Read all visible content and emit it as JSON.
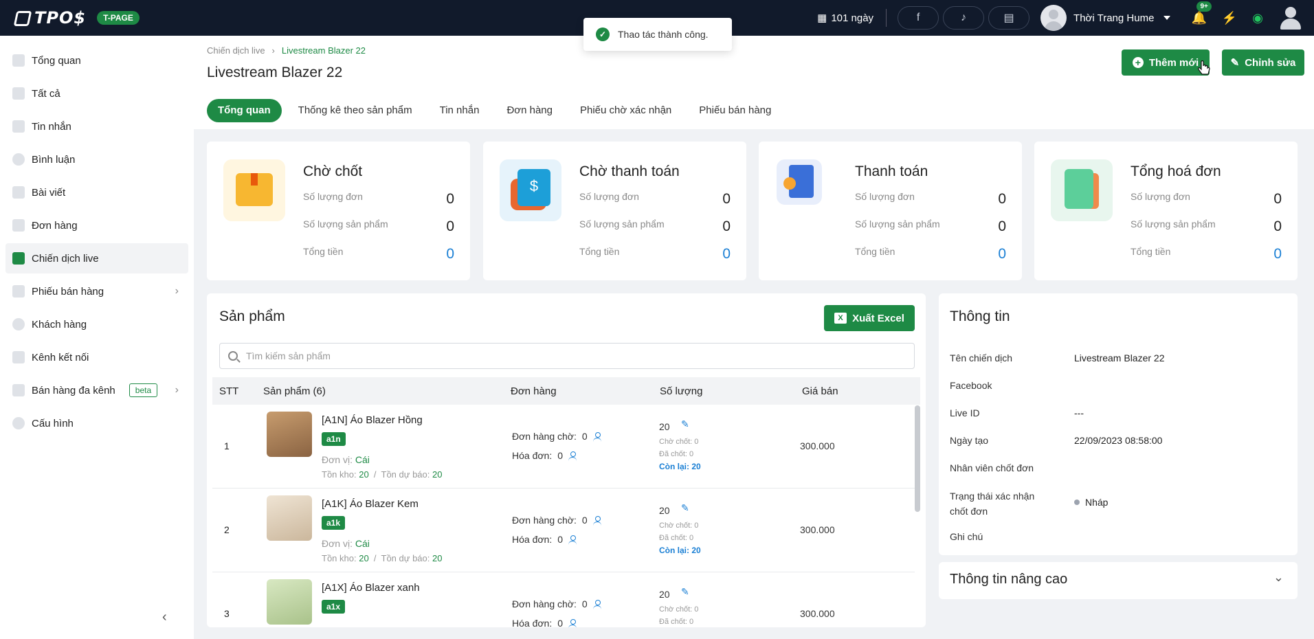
{
  "topbar": {
    "logo_text": "TPO$",
    "badge": "T-PAGE",
    "days": "101 ngày",
    "shop_name": "Thời Trang Hume",
    "notif_count": "9+"
  },
  "toast": {
    "message": "Thao tác thành công."
  },
  "sidebar": {
    "items": [
      {
        "label": "Tổng quan"
      },
      {
        "label": "Tất cả"
      },
      {
        "label": "Tin nhắn"
      },
      {
        "label": "Bình luận"
      },
      {
        "label": "Bài viết"
      },
      {
        "label": "Đơn hàng"
      },
      {
        "label": "Chiến dịch live"
      },
      {
        "label": "Phiếu bán hàng"
      },
      {
        "label": "Khách hàng"
      },
      {
        "label": "Kênh kết nối"
      },
      {
        "label": "Bán hàng đa kênh",
        "badge": "beta"
      },
      {
        "label": "Cấu hình"
      }
    ]
  },
  "header": {
    "breadcrumb": [
      "Chiến dịch live",
      "Livestream Blazer 22"
    ],
    "title": "Livestream Blazer 22",
    "add_button": "Thêm mới",
    "edit_button": "Chỉnh sửa",
    "tabs": [
      "Tổng quan",
      "Thống kê theo sản phẩm",
      "Tin nhắn",
      "Đơn hàng",
      "Phiếu chờ xác nhận",
      "Phiếu bán hàng"
    ]
  },
  "cards": [
    {
      "title": "Chờ chốt",
      "row1_label": "Số lượng đơn",
      "row1_value": "0",
      "row2_label": "Số lượng sản phẩm",
      "row2_value": "0",
      "row3_label": "Tổng tiền",
      "row3_value": "0"
    },
    {
      "title": "Chờ thanh toán",
      "row1_label": "Số lượng đơn",
      "row1_value": "0",
      "row2_label": "Số lượng sản phẩm",
      "row2_value": "0",
      "row3_label": "Tổng tiền",
      "row3_value": "0"
    },
    {
      "title": "Thanh toán",
      "row1_label": "Số lượng đơn",
      "row1_value": "0",
      "row2_label": "Số lượng sản phẩm",
      "row2_value": "0",
      "row3_label": "Tổng tiền",
      "row3_value": "0"
    },
    {
      "title": "Tổng hoá đơn",
      "row1_label": "Số lượng đơn",
      "row1_value": "0",
      "row2_label": "Số lượng sản phẩm",
      "row2_value": "0",
      "row3_label": "Tổng tiền",
      "row3_value": "0"
    }
  ],
  "products": {
    "title": "Sản phẩm",
    "excel_button": "Xuất Excel",
    "search_placeholder": "Tìm kiếm sản phẩm",
    "columns": [
      "STT",
      "Sản phẩm (6)",
      "Đơn hàng",
      "Số lượng",
      "Giá bán"
    ],
    "rows": [
      {
        "stt": "1",
        "name": "[A1N] Áo Blazer Hồng",
        "tag": "a1n",
        "unit_label": "Đơn vị:",
        "unit": "Cái",
        "stock_label": "Tồn kho:",
        "stock": "20",
        "forecast_label": "Tồn dự báo:",
        "forecast": "20",
        "pending_label": "Đơn hàng chờ:",
        "pending": "0",
        "invoice_label": "Hóa đơn:",
        "invoice": "0",
        "qty": "20",
        "wait_close": "Chờ chốt: 0",
        "closed": "Đã chốt: 0",
        "remaining": "Còn lại: 20",
        "price": "300.000",
        "color": "#b78a5c"
      },
      {
        "stt": "2",
        "name": "[A1K] Áo Blazer Kem",
        "tag": "a1k",
        "unit_label": "Đơn vị:",
        "unit": "Cái",
        "stock_label": "Tồn kho:",
        "stock": "20",
        "forecast_label": "Tồn dự báo:",
        "forecast": "20",
        "pending_label": "Đơn hàng chờ:",
        "pending": "0",
        "invoice_label": "Hóa đơn:",
        "invoice": "0",
        "qty": "20",
        "wait_close": "Chờ chốt: 0",
        "closed": "Đã chốt: 0",
        "remaining": "Còn lại: 20",
        "price": "300.000",
        "color": "#e2d3bf"
      },
      {
        "stt": "3",
        "name": "[A1X] Áo Blazer xanh",
        "tag": "a1x",
        "unit_label": "",
        "unit": "",
        "stock_label": "",
        "stock": "",
        "forecast_label": "",
        "forecast": "",
        "pending_label": "Đơn hàng chờ:",
        "pending": "0",
        "invoice_label": "Hóa đơn:",
        "invoice": "0",
        "qty": "20",
        "wait_close": "Chờ chốt: 0",
        "closed": "Đã chốt: 0",
        "remaining": "",
        "price": "300.000",
        "color": "#c9ddb0"
      }
    ]
  },
  "info": {
    "title": "Thông tin",
    "fields": [
      {
        "label": "Tên chiến dịch",
        "value": "Livestream Blazer 22"
      },
      {
        "label": "Facebook",
        "value": ""
      },
      {
        "label": "Live ID",
        "value": "---"
      },
      {
        "label": "Ngày tạo",
        "value": "22/09/2023 08:58:00"
      },
      {
        "label": "Nhân viên chốt đơn",
        "value": ""
      },
      {
        "label": "Trạng thái xác nhận chốt đơn",
        "value": "Nháp"
      },
      {
        "label": "Ghi chú",
        "value": ""
      }
    ],
    "advanced_title": "Thông tin nâng cao"
  },
  "colors": {
    "brand_green": "#1e8a45",
    "topbar_bg": "#111a2b",
    "link_blue": "#1a7fd4"
  }
}
